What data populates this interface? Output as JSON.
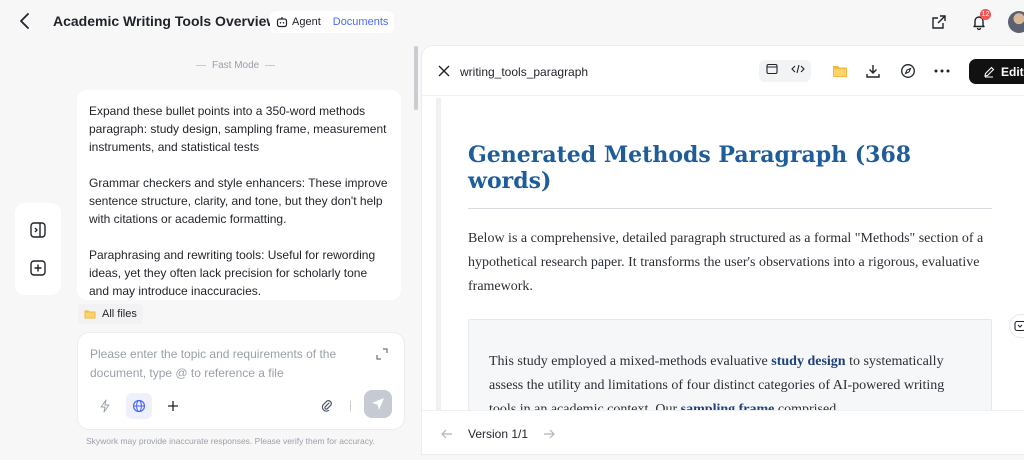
{
  "header": {
    "title": "Academic Writing Tools Overview",
    "agent_label": "Agent",
    "documents_label": "Documents",
    "notification_count": "12"
  },
  "chat": {
    "fast_mode_label": "Fast Mode",
    "paragraphs": [
      "Expand these bullet points into a 350-word methods paragraph: study design, sampling frame, measurement instruments, and statistical tests",
      "Grammar checkers and style enhancers: These improve sentence structure, clarity, and tone, but they don't help with citations or academic formatting.",
      "Paraphrasing and rewriting tools: Useful for rewording ideas, yet they often lack precision for scholarly tone and may introduce inaccuracies."
    ],
    "all_files_label": "All files",
    "input_placeholder": "Please enter the topic and requirements of the document, type @ to reference a file",
    "disclaimer": "Skywork may provide inaccurate responses. Please verify them for accuracy."
  },
  "document": {
    "file_name": "writing_tools_paragraph",
    "edit_label": "Edit",
    "heading": "Generated Methods Paragraph (368 words)",
    "intro": "Below is a comprehensive, detailed paragraph structured as a formal \"Methods\" section of a hypothetical research paper. It transforms the user's observations into a rigorous, evaluative framework.",
    "quote": {
      "part1": "This study employed a mixed-methods evaluative ",
      "bold1": "study design",
      "part2": " to systematically assess the utility and limitations of four distinct categories of AI-powered writing tools in an academic context. Our ",
      "bold2": "sampling frame",
      "part3": " comprised"
    },
    "version_label": "Version 1/1"
  },
  "colors": {
    "accent": "#4a6cf7",
    "heading": "#1f5c9a",
    "edit_button": "#111111"
  }
}
